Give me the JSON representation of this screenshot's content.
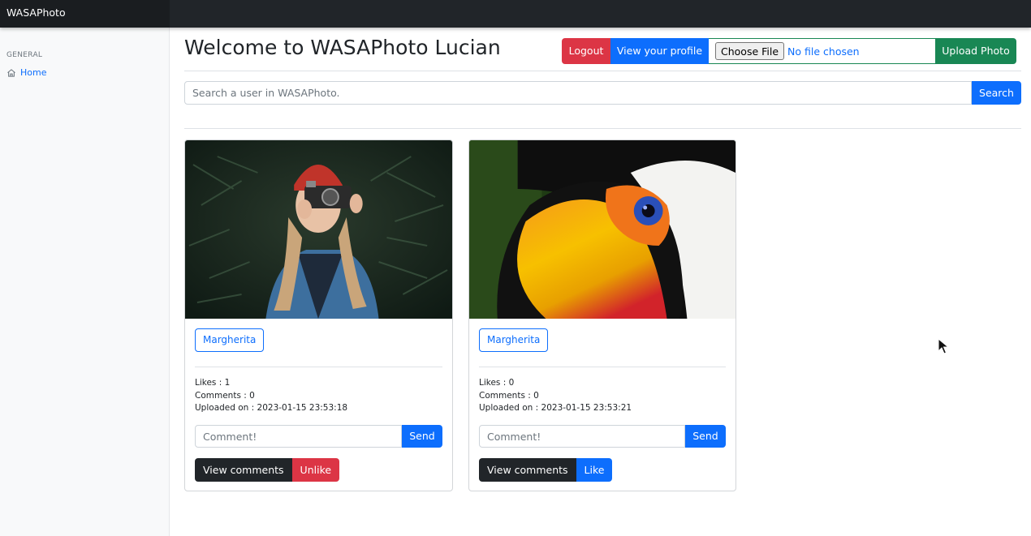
{
  "app": {
    "brand": "WASAPhoto"
  },
  "sidebar": {
    "heading": "GENERAL",
    "items": [
      {
        "label": "Home",
        "icon": "home-icon"
      }
    ]
  },
  "header": {
    "welcome": "Welcome to WASAPhoto Lucian",
    "logout_label": "Logout",
    "profile_label": "View your profile",
    "choose_file_label": "Choose File",
    "file_status": "No file chosen",
    "upload_label": "Upload Photo"
  },
  "search": {
    "placeholder": "Search a user in WASAPhoto.",
    "button_label": "Search"
  },
  "posts": [
    {
      "owner": "Margherita",
      "likes": "Likes : 1",
      "comments": "Comments : 0",
      "uploaded": "Uploaded on : 2023-01-15 23:53:18",
      "comment_placeholder": "Comment!",
      "send_label": "Send",
      "view_comments_label": "View comments",
      "like_label": "Unlike"
    },
    {
      "owner": "Margherita",
      "likes": "Likes : 0",
      "comments": "Comments : 0",
      "uploaded": "Uploaded on : 2023-01-15 23:53:21",
      "comment_placeholder": "Comment!",
      "send_label": "Send",
      "view_comments_label": "View comments",
      "like_label": "Like"
    }
  ],
  "colors": {
    "topbar": "#212529",
    "primary": "#0d6efd",
    "danger": "#dc3545",
    "success": "#198754",
    "dark": "#212529",
    "sidebar": "#f8f9fa"
  }
}
